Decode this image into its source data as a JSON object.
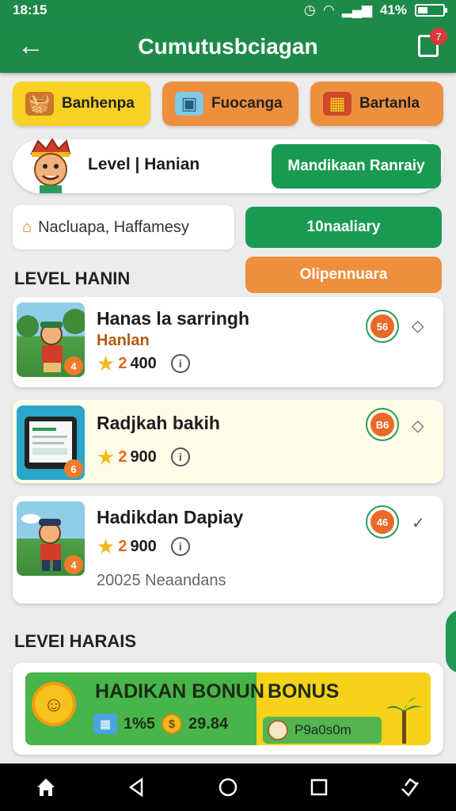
{
  "status_bar": {
    "time": "18:15",
    "battery": "41%",
    "battery_fill": 0.41
  },
  "app_bar": {
    "title": "Cumutusbciagan",
    "badge_count": "7"
  },
  "categories": [
    {
      "label": "Banhenpa",
      "icon": "basket-icon"
    },
    {
      "label": "Fuocanga",
      "icon": "bucket-icon"
    },
    {
      "label": "Bartanla",
      "icon": "gift-box-icon"
    }
  ],
  "level_card": {
    "label": "Level | Hanian",
    "button": "Mandikaan Ranraiy"
  },
  "location": {
    "value": "Nacluapa, Haffamesy"
  },
  "buttons": {
    "green": "10naaliary",
    "orange": "Olipennuara"
  },
  "sections": {
    "first": "LEVEL HANIN",
    "second": "LEVEI HARAIS"
  },
  "items": [
    {
      "title": "Hanas la sarringh",
      "subtitle": "Hanlan",
      "star_value": "2",
      "points": "400",
      "badge": "56",
      "num": "4",
      "chevron": "◇"
    },
    {
      "title": "Radjkah bakih",
      "star_value": "2",
      "points": "900",
      "badge": "B6",
      "num": "6",
      "chevron": "◇"
    },
    {
      "title": "Hadikdan Dapiay",
      "star_value": "2",
      "points": "900",
      "badge": "46",
      "num": "4",
      "chevron": "✓",
      "date": "20025 Neaandans"
    }
  ],
  "bonus": {
    "title_left": "HADIKAN BONUN",
    "title_right": "BONUS",
    "count": "1%5",
    "coins": "29.84",
    "pill": "P9a0s0m"
  },
  "colors": {
    "primary_green": "#1e8a4a",
    "button_green": "#199a52",
    "orange": "#ee8f3e",
    "yellow": "#f7d124"
  }
}
